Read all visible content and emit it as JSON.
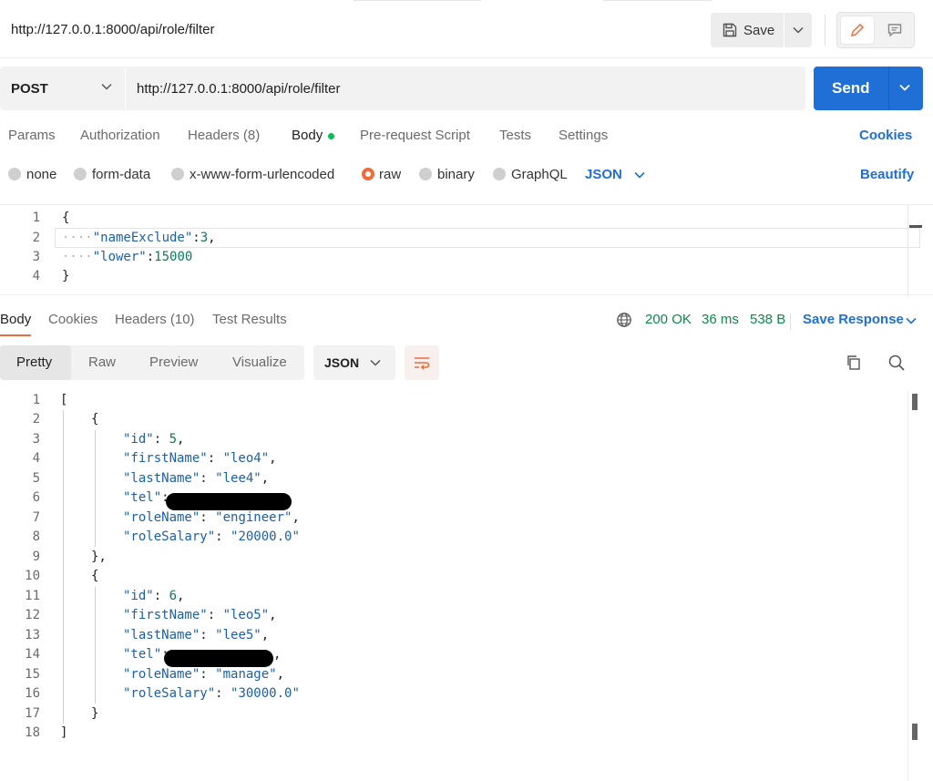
{
  "topbar": {
    "title": "http://127.0.0.1:8000/api/role/filter",
    "save_label": "Save"
  },
  "request": {
    "method": "POST",
    "url": "http://127.0.0.1:8000/api/role/filter",
    "send_label": "Send"
  },
  "request_tabs": {
    "params": "Params",
    "authorization": "Authorization",
    "headers": "Headers (8)",
    "body": "Body",
    "prerequest": "Pre-request Script",
    "tests": "Tests",
    "settings": "Settings",
    "cookies": "Cookies"
  },
  "body_options": {
    "none": "none",
    "form_data": "form-data",
    "urlencoded": "x-www-form-urlencoded",
    "raw": "raw",
    "binary": "binary",
    "graphql": "GraphQL",
    "format": "JSON",
    "beautify": "Beautify",
    "selected": "raw"
  },
  "request_body": {
    "line_numbers": [
      "1",
      "2",
      "3",
      "4"
    ],
    "l1": "{",
    "l2_key": "\"nameExclude\"",
    "l2_colon": ":",
    "l2_val": "3",
    "l2_end": ",",
    "l3_key": "\"lower\"",
    "l3_colon": ":",
    "l3_val": "15000",
    "l4": "}",
    "indent_dots": "····"
  },
  "response_tabs": {
    "body": "Body",
    "cookies": "Cookies",
    "headers": "Headers (10)",
    "test_results": "Test Results",
    "status": "200 OK",
    "time": "36 ms",
    "size": "538 B",
    "save_response": "Save Response"
  },
  "response_view": {
    "pretty": "Pretty",
    "raw": "Raw",
    "preview": "Preview",
    "visualize": "Visualize",
    "format": "JSON"
  },
  "response_body": {
    "line_numbers": [
      "1",
      "2",
      "3",
      "4",
      "5",
      "6",
      "7",
      "8",
      "9",
      "10",
      "11",
      "12",
      "13",
      "14",
      "15",
      "16",
      "17",
      "18"
    ],
    "open_bracket": "[",
    "close_bracket": "]",
    "open_brace": "{",
    "close_brace_comma": "},",
    "close_brace": "}",
    "records": [
      {
        "id": "5",
        "firstName": "\"leo4\"",
        "lastName": "\"lee4\"",
        "roleName": "\"engineer\"",
        "roleSalary": "\"20000.0\""
      },
      {
        "id": "6",
        "firstName": "\"leo5\"",
        "lastName": "\"lee5\"",
        "roleName": "\"manage\"",
        "roleSalary": "\"30000.0\""
      }
    ],
    "keys": {
      "id": "\"id\"",
      "firstName": "\"firstName\"",
      "lastName": "\"lastName\"",
      "tel": "\"tel\"",
      "roleName": "\"roleName\"",
      "roleSalary": "\"roleSalary\""
    }
  },
  "colors": {
    "accent_blue": "#1f6fd6",
    "accent_orange": "#f26b3a",
    "status_green": "#0b8a4a",
    "string_blue": "#1b5fae",
    "number_green": "#0b7c5b"
  }
}
